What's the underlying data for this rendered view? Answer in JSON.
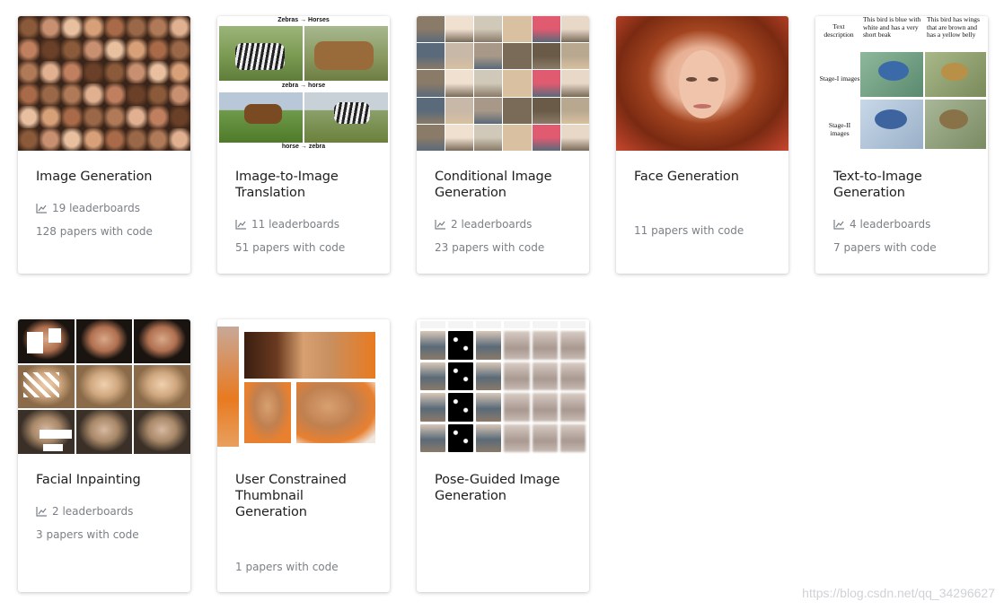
{
  "cards": [
    {
      "title": "Image Generation",
      "leaderboards": "19 leaderboards",
      "papers": "128 papers with code"
    },
    {
      "title": "Image-to-Image Translation",
      "leaderboards": "11 leaderboards",
      "papers": "51 papers with code",
      "thumb": {
        "top_caption": "Zebras → Horses",
        "left_caption": "zebra → horse",
        "right_caption": "horse → zebra"
      }
    },
    {
      "title": "Conditional Image Generation",
      "leaderboards": "2 leaderboards",
      "papers": "23 papers with code"
    },
    {
      "title": "Face Generation",
      "papers": "11 papers with code"
    },
    {
      "title": "Text-to-Image Generation",
      "leaderboards": "4 leaderboards",
      "papers": "7 papers with code",
      "thumb": {
        "text_desc": "Text description",
        "desc1": "This bird is blue with white and has a very short beak",
        "desc2": "This bird has wings that are brown and has a yellow belly",
        "stage1": "Stage-I images",
        "stage2": "Stage-II images"
      }
    },
    {
      "title": "Facial Inpainting",
      "leaderboards": "2 leaderboards",
      "papers": "3 papers with code"
    },
    {
      "title": "User Constrained Thumbnail Generation",
      "papers": "1 papers with code"
    },
    {
      "title": "Pose-Guided Image Generation"
    }
  ],
  "watermark": "https://blog.csdn.net/qq_34296627",
  "icons": {
    "leaderboard": "line-chart-icon"
  },
  "colors": {
    "title": "#1e1e1e",
    "muted": "#7b8086"
  }
}
